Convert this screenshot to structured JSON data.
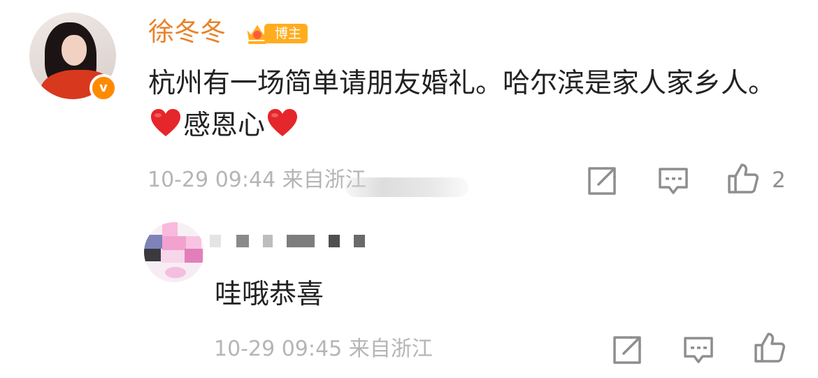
{
  "post": {
    "username": "徐冬冬",
    "badge_label": "博主",
    "verified_mark": "v",
    "text": "杭州有一场简单请朋友婚礼。哈尔滨是家人家乡人。",
    "text_emoji_part": "感恩心",
    "timestamp": "10-29 09:44",
    "location": "来自浙江",
    "like_count": "2",
    "icons": [
      "share-icon",
      "comment-icon",
      "like-icon"
    ],
    "emoji": "heart-emoji",
    "colors": {
      "username": "#e8832a",
      "badge": "#ffad1f",
      "verified": "#ff8a00",
      "meta": "#b5b5b5"
    }
  },
  "reply": {
    "username_masked": "",
    "text": "哇哦恭喜",
    "timestamp": "10-29 09:45",
    "location": "来自浙江",
    "icons": [
      "share-icon",
      "comment-icon",
      "like-icon"
    ]
  }
}
